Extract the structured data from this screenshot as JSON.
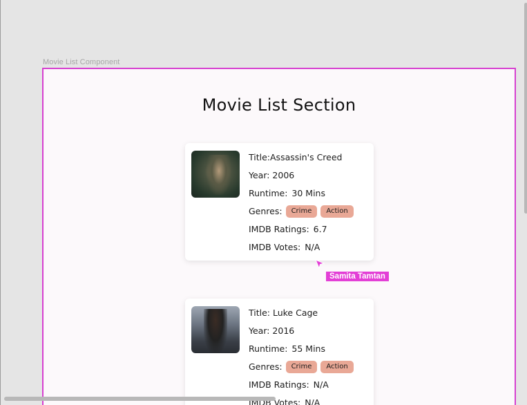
{
  "frame_label": "Movie List Component",
  "section_title": "Movie List Section",
  "movies": [
    {
      "title_label": "Title:Assassin's Creed",
      "year_label": "Year: 2006",
      "runtime_label": "Runtime:",
      "runtime_value": "30 Mins",
      "genres_label": "Genres:",
      "genres": [
        "Crime",
        "Action"
      ],
      "rating_label": "IMDB Ratings:",
      "rating_value": "6.7",
      "votes_label": "IMDB Votes:",
      "votes_value": "N/A"
    },
    {
      "title_label": "Title: Luke Cage",
      "year_label": "Year: 2016",
      "runtime_label": "Runtime:",
      "runtime_value": "55 Mins",
      "genres_label": "Genres:",
      "genres": [
        "Crime",
        "Action"
      ],
      "rating_label": "IMDB Ratings:",
      "rating_value": "N/A",
      "votes_label": "IMDB Votes:",
      "votes_value": "N/A"
    }
  ],
  "collaborator": {
    "name": "Samita Tamtan",
    "color": "#e33fd6"
  },
  "colors": {
    "frame_border": "#d63fd0",
    "genre_tag": "#e9a896"
  },
  "icons": {
    "cursor": "cursor-icon"
  }
}
